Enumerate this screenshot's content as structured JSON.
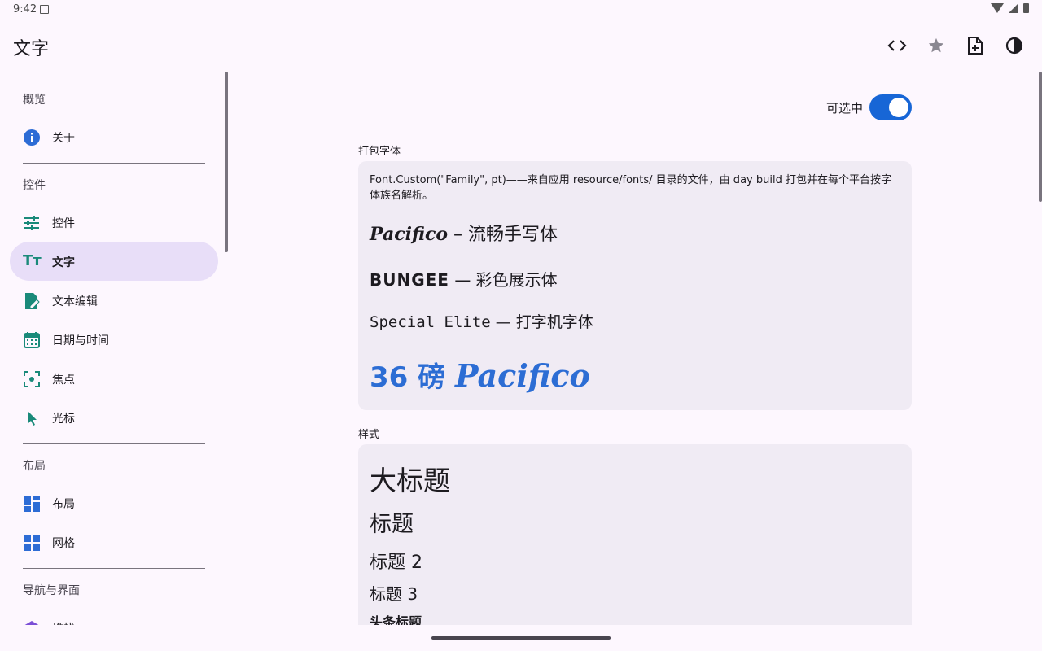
{
  "status": {
    "time": "9:42"
  },
  "appbar": {
    "title": "文字",
    "actions": [
      {
        "icon": "code-icon"
      },
      {
        "icon": "star-icon"
      },
      {
        "icon": "add-document-icon"
      },
      {
        "icon": "contrast-icon"
      }
    ]
  },
  "nav": {
    "sections": [
      {
        "header": "概览",
        "items": [
          {
            "label": "关于",
            "icon": "info-icon"
          }
        ]
      },
      {
        "header": "控件",
        "items": [
          {
            "label": "控件",
            "icon": "tune-icon"
          },
          {
            "label": "文字",
            "icon": "text-fields-icon",
            "active": true
          },
          {
            "label": "文本编辑",
            "icon": "edit-document-icon"
          },
          {
            "label": "日期与时间",
            "icon": "calendar-icon"
          },
          {
            "label": "焦点",
            "icon": "focus-icon"
          },
          {
            "label": "光标",
            "icon": "cursor-icon"
          }
        ]
      },
      {
        "header": "布局",
        "items": [
          {
            "label": "布局",
            "icon": "dashboard-icon"
          },
          {
            "label": "网格",
            "icon": "grid-icon"
          }
        ]
      },
      {
        "header": "导航与界面",
        "items": [
          {
            "label": "堆栈",
            "icon": "layers-icon"
          }
        ]
      }
    ]
  },
  "content": {
    "selectable_label": "可选中",
    "selectable_on": true,
    "bundled": {
      "label": "打包字体",
      "description": "Font.Custom(\"Family\", pt)——来自应用 resource/fonts/ 目录的文件，由 day build 打包并在每个平台按字体族名解析。",
      "line1_font": "Pacifico",
      "line1_rest": " – 流畅手写体",
      "line2_font": "BUNGEE",
      "line2_rest": " — 彩色展示体",
      "line3_font": "Special Elite",
      "line3_rest": " — 打字机字体",
      "line4_size": "36 磅 ",
      "line4_font": "Pacifico"
    },
    "styles": {
      "label": "样式",
      "large_title": "大标题",
      "title": "标题",
      "title2": "标题 2",
      "title3": "标题 3",
      "headline": "头条标题"
    }
  },
  "colors": {
    "accent": "#1766d6",
    "active_nav_bg": "#e8def8",
    "card_bg": "#f0ebf4",
    "nav_icon_teal": "#1a8a7a"
  }
}
